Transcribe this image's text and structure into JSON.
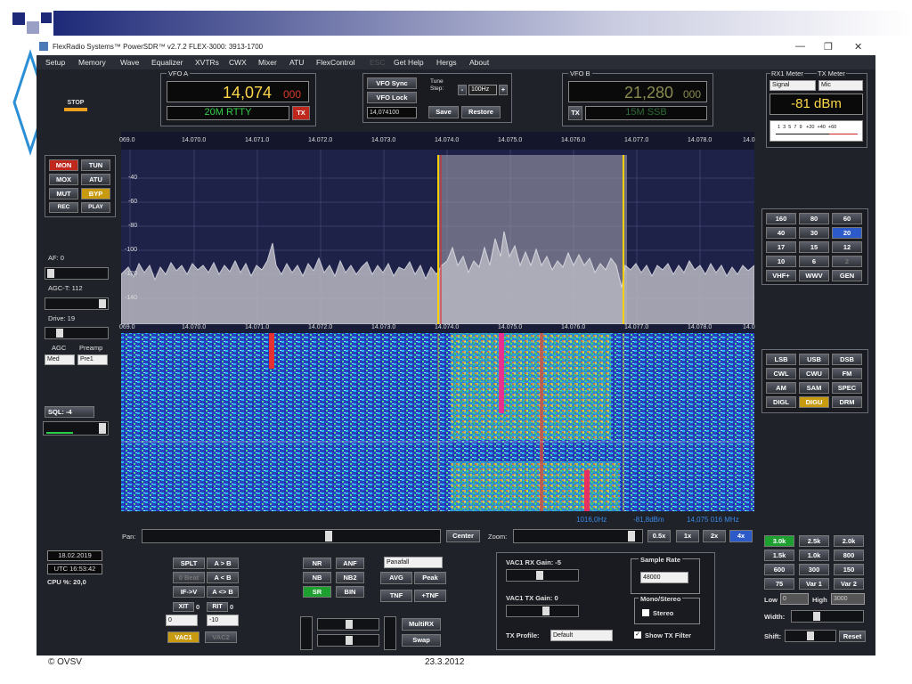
{
  "slide": {
    "footer_left": "© OVSV",
    "footer_center": "23.3.2012"
  },
  "window": {
    "title": "FlexRadio Systems™ PowerSDR™ v2.7.2  FLEX-3000: 3913-1700",
    "min_icon": "minimize-icon",
    "max_icon": "maximize-icon",
    "close_icon": "close-icon"
  },
  "menu": [
    "Setup",
    "Memory",
    "Wave",
    "Equalizer",
    "XVTRs",
    "CWX",
    "Mixer",
    "ATU",
    "FlexControl",
    "ESC",
    "Get Help",
    "Hergs",
    "About"
  ],
  "stop_label": "STOP",
  "vfo_a": {
    "label": "VFO A",
    "freq_main": "14,074",
    "freq_sub": "000",
    "band": "20M RTTY",
    "tx": "TX"
  },
  "vfo_ctrl": {
    "sync": "VFO Sync",
    "lock": "VFO Lock",
    "tune_label": "Tune Step:",
    "tune_value": "100Hz",
    "minus": "-",
    "plus": "+",
    "freq": "14,074100",
    "save": "Save",
    "restore": "Restore"
  },
  "vfo_b": {
    "label": "VFO B",
    "freq_main": "21,280",
    "freq_sub": "000",
    "band": "15M SSB",
    "tx": "TX"
  },
  "meters": {
    "rx_label": "RX1 Meter",
    "tx_label": "TX Meter",
    "rx_sel": "Signal",
    "tx_sel": "Mic",
    "reading": "-81 dBm",
    "scale": "1  3  5  7  9   +20  +40  +60"
  },
  "left_buttons": [
    [
      "MON",
      "TUN"
    ],
    [
      "MOX",
      "ATU"
    ],
    [
      "MUT",
      "BYP"
    ],
    [
      "REC",
      "PLAY"
    ]
  ],
  "left": {
    "af": "AF: 0",
    "agct": "AGC-T: 112",
    "drive": "Drive: 19",
    "agc": "AGC",
    "preamp": "Preamp",
    "agc_val": "Med",
    "preamp_val": "Pre1",
    "sql": "SQL: -4"
  },
  "freq_ticks": [
    "069.0",
    "14.070.0",
    "14.071.0",
    "14.072.0",
    "14.073.0",
    "14.074.0",
    "14.075.0",
    "14.076.0",
    "14.077.0",
    "14.078.0",
    "14.0"
  ],
  "db_ticks": [
    "-40",
    "-60",
    "-80",
    "-100",
    "-120",
    "-140"
  ],
  "status": {
    "offset": "1016,0Hz",
    "dbm": "-81,8dBm",
    "freq": "14,075 016 MHz"
  },
  "bands": [
    [
      "160",
      "80",
      "60"
    ],
    [
      "40",
      "30",
      "20"
    ],
    [
      "17",
      "15",
      "12"
    ],
    [
      "10",
      "6",
      "2"
    ],
    [
      "VHF+",
      "WWV",
      "GEN"
    ]
  ],
  "modes": [
    [
      "LSB",
      "USB",
      "DSB"
    ],
    [
      "CWL",
      "CWU",
      "FM"
    ],
    [
      "AM",
      "SAM",
      "SPEC"
    ],
    [
      "DIGL",
      "DIGU",
      "DRM"
    ]
  ],
  "pan": {
    "label": "Pan:",
    "center": "Center",
    "zoom": "Zoom:",
    "z05": "0.5x",
    "z1": "1x",
    "z2": "2x",
    "z4": "4x"
  },
  "datetime": {
    "date": "18.02.2019",
    "utc": "UTC 16:53:42",
    "cpu": "CPU %: 20,0"
  },
  "split": {
    "splt": "SPLT",
    "atob": "A > B",
    "zerobeat": "0 Beat",
    "btoa": "A < B",
    "ifv": "IF->V",
    "swap": "A <> B",
    "xit": "XIT",
    "xit_v": "0",
    "rit": "RIT",
    "rit_v": "0",
    "xit_in": "0",
    "rit_in": "-10",
    "vac1": "VAC1",
    "vac2": "VAC2"
  },
  "dsp": {
    "nr": "NR",
    "anf": "ANF",
    "nb": "NB",
    "nb2": "NB2",
    "sr": "SR",
    "bin": "BIN",
    "display_sel": "Panafall",
    "avg": "AVG",
    "peak": "Peak",
    "tnf": "TNF",
    "ptnf": "+TNF",
    "multirx": "MultiRX",
    "swap": "Swap"
  },
  "vac": {
    "rx_gain": "VAC1 RX Gain: -5",
    "tx_gain": "VAC1 TX Gain: 0",
    "sample_rate": "Sample Rate",
    "rate_val": "48000",
    "mono": "Mono/Stereo",
    "stereo": "Stereo",
    "txprofile": "TX Profile:",
    "profile_val": "Default",
    "show_tx": "Show TX Filter"
  },
  "filters": [
    [
      "3.0k",
      "2.5k",
      "2.0k"
    ],
    [
      "1.5k",
      "1.0k",
      "800"
    ],
    [
      "600",
      "300",
      "150"
    ],
    [
      "75",
      "Var 1",
      "Var 2"
    ]
  ],
  "filter_ctrl": {
    "low": "Low",
    "low_v": "0",
    "high": "High",
    "high_v": "3000",
    "width": "Width:",
    "shift": "Shift:",
    "reset": "Reset"
  }
}
